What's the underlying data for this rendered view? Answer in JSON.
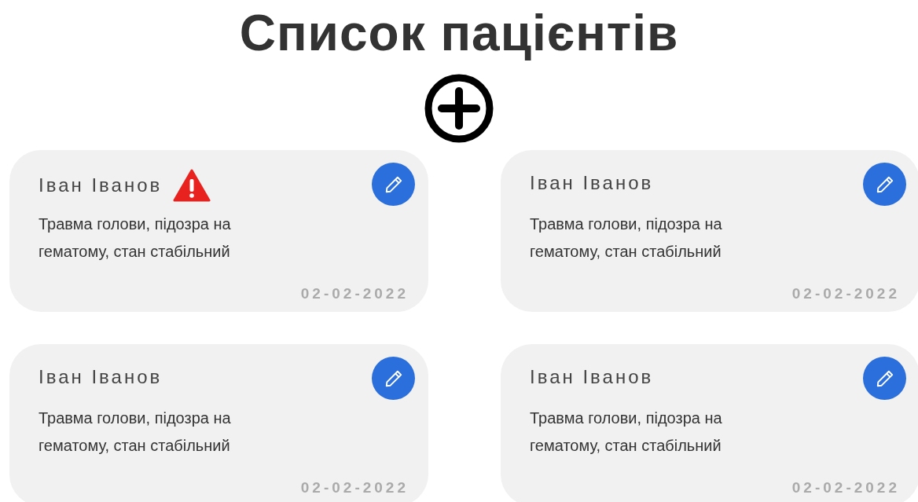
{
  "title": "Список пацієнтів",
  "patients": [
    {
      "name": "Іван Іванов",
      "alert": true,
      "description": "Травма голови, підозра на гематому, стан стабільний",
      "date": "02-02-2022"
    },
    {
      "name": "Іван Іванов",
      "alert": false,
      "description": "Травма голови, підозра на гематому, стан стабільний",
      "date": "02-02-2022"
    },
    {
      "name": "Іван Іванов",
      "alert": false,
      "description": "Травма голови, підозра на гематому, стан стабільний",
      "date": "02-02-2022"
    },
    {
      "name": "Іван Іванов",
      "alert": false,
      "description": "Травма голови, підозра на гематому, стан стабільний",
      "date": "02-02-2022"
    }
  ]
}
